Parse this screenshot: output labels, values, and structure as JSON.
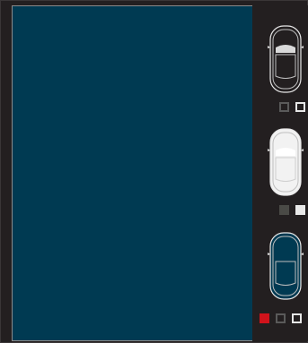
{
  "colors": {
    "background": "#231f20",
    "canvas": "#003a52",
    "canvas_border": "#8a8a8a"
  },
  "cars": [
    {
      "icon": "car-top-view-icon",
      "body_color": "#231f20",
      "roof_color": "#d9d9d9",
      "swatches": [
        {
          "name": "swatch-dark-grey",
          "fill": "#231f20",
          "border": "#5a5a5a"
        },
        {
          "name": "swatch-white",
          "fill": "#231f20",
          "border": "#e6e6e6"
        }
      ]
    },
    {
      "icon": "car-top-view-icon",
      "body_color": "#f2f2f2",
      "roof_color": "#ffffff",
      "swatches": [
        {
          "name": "swatch-grey",
          "fill": "#4a4a46",
          "border": "#4a4a46"
        },
        {
          "name": "swatch-white",
          "fill": "#e8e8e8",
          "border": "#e8e8e8"
        }
      ]
    },
    {
      "icon": "car-top-view-icon",
      "body_color": "#003a52",
      "roof_color": "#003a52",
      "swatches": [
        {
          "name": "swatch-red",
          "fill": "#d0131b",
          "border": "#d0131b"
        },
        {
          "name": "swatch-dark-grey",
          "fill": "#231f20",
          "border": "#5a5a5a"
        },
        {
          "name": "swatch-white",
          "fill": "#231f20",
          "border": "#e6e6e6"
        }
      ]
    }
  ]
}
